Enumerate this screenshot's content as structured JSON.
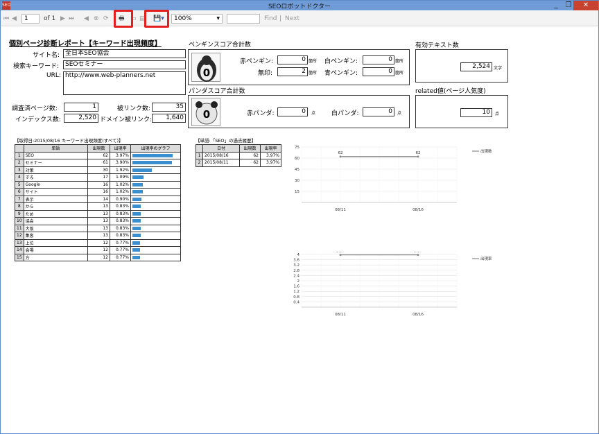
{
  "window": {
    "title": "SEOロボットドクター",
    "app_icon": "app-icon",
    "controls": [
      "_",
      "❐",
      "✕"
    ]
  },
  "toolbar": {
    "page_current": "1",
    "page_of": "of 1",
    "zoom": "100%",
    "find": "Find",
    "next": "Next",
    "separator": "|"
  },
  "report": {
    "title": "個別ページ診断レポート【キーワード出現頻度】",
    "site_label": "サイト名:",
    "site_value": "全日本SEO協会",
    "keyword_label": "検索キーワード:",
    "keyword_value": "SEOセミナー",
    "url_label": "URL:",
    "url_value": "http://www.web-planners.net",
    "pages_label": "調査済ページ数:",
    "pages_value": "1",
    "backlinks_label": "被リンク数:",
    "backlinks_value": "35",
    "index_label": "インデックス数:",
    "index_value": "2,520",
    "domain_backlinks_label": "ドメイン被リンク:",
    "domain_backlinks_value": "1,640"
  },
  "penguin": {
    "heading": "ペンギンスコア合計数",
    "score": "0",
    "red_label": "赤ペンギン:",
    "red_value": "0",
    "white_label": "白ペンギン:",
    "white_value": "0",
    "none_label": "無印:",
    "none_value": "2",
    "blue_label": "青ペンギン:",
    "blue_value": "0",
    "unit": "箇所"
  },
  "panda": {
    "heading": "パンダスコア合計数",
    "score": "0",
    "red_label": "赤パンダ:",
    "red_value": "0",
    "white_label": "白パンダ:",
    "white_value": "0",
    "unit": "点"
  },
  "text_count": {
    "heading": "有効テキスト数",
    "value": "2,524",
    "unit": "文字"
  },
  "related": {
    "heading": "related値(ページ人気度)",
    "value": "10",
    "unit": "点"
  },
  "keyword_table": {
    "caption": "【取得日:2015/08/16 キーワード出現頻度(すべて)】",
    "headers": [
      "単語",
      "出現数",
      "出現率",
      "出現率のグラフ"
    ],
    "rows": [
      {
        "n": "1",
        "word": "SEO",
        "count": "62",
        "rate": "3.97%",
        "pct": 3.97
      },
      {
        "n": "2",
        "word": "セミナー",
        "count": "61",
        "rate": "3.90%",
        "pct": 3.9
      },
      {
        "n": "3",
        "word": "対策",
        "count": "30",
        "rate": "1.92%",
        "pct": 1.92
      },
      {
        "n": "4",
        "word": "する",
        "count": "17",
        "rate": "1.09%",
        "pct": 1.09
      },
      {
        "n": "5",
        "word": "Google",
        "count": "16",
        "rate": "1.02%",
        "pct": 1.02
      },
      {
        "n": "6",
        "word": "サイト",
        "count": "16",
        "rate": "1.02%",
        "pct": 1.02
      },
      {
        "n": "7",
        "word": "表示",
        "count": "14",
        "rate": "0.90%",
        "pct": 0.9
      },
      {
        "n": "8",
        "word": "から",
        "count": "13",
        "rate": "0.83%",
        "pct": 0.83
      },
      {
        "n": "9",
        "word": "ため",
        "count": "13",
        "rate": "0.83%",
        "pct": 0.83
      },
      {
        "n": "10",
        "word": "協会",
        "count": "13",
        "rate": "0.83%",
        "pct": 0.83
      },
      {
        "n": "11",
        "word": "大阪",
        "count": "13",
        "rate": "0.83%",
        "pct": 0.83
      },
      {
        "n": "12",
        "word": "集客",
        "count": "13",
        "rate": "0.83%",
        "pct": 0.83
      },
      {
        "n": "13",
        "word": "上位",
        "count": "12",
        "rate": "0.77%",
        "pct": 0.77
      },
      {
        "n": "14",
        "word": "会場",
        "count": "12",
        "rate": "0.77%",
        "pct": 0.77
      },
      {
        "n": "15",
        "word": "方",
        "count": "12",
        "rate": "0.77%",
        "pct": 0.77
      }
    ]
  },
  "history_table": {
    "caption": "【単語:「SEO」の過去履歴】",
    "headers": [
      "日付",
      "出現数",
      "出現率"
    ],
    "rows": [
      {
        "n": "1",
        "date": "2015/08/16",
        "count": "62",
        "rate": "3.97%"
      },
      {
        "n": "2",
        "date": "2015/08/11",
        "count": "62",
        "rate": "3.97%"
      }
    ]
  },
  "chart_data": [
    {
      "type": "line",
      "categories": [
        "08/11",
        "08/16"
      ],
      "series": [
        {
          "name": "出現数",
          "values": [
            62,
            62
          ]
        }
      ],
      "data_labels": [
        "62",
        "62"
      ],
      "yticks": [
        "75",
        "60",
        "45",
        "30",
        "15"
      ],
      "ylim": [
        0,
        75
      ],
      "grid": true,
      "legend": "right",
      "color": "#8a8a8a"
    },
    {
      "type": "line",
      "categories": [
        "08/11",
        "08/16"
      ],
      "series": [
        {
          "name": "出現率",
          "values": [
            3.97,
            3.97
          ]
        }
      ],
      "data_labels": [
        "3.97",
        "3.97"
      ],
      "yticks": [
        "4",
        "3.6",
        "3.2",
        "2.8",
        "2.4",
        "2",
        "1.6",
        "1.2",
        "0.8",
        "0.4"
      ],
      "ylim": [
        0,
        4
      ],
      "grid": true,
      "legend": "right",
      "color": "#8a8a8a"
    }
  ]
}
